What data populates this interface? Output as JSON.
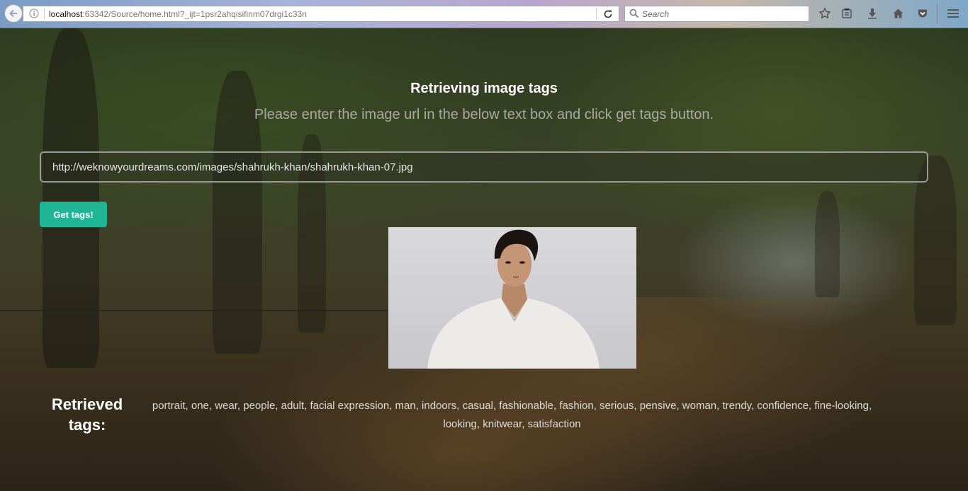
{
  "browser": {
    "url_host": "localhost",
    "url_rest": ":63342/Source/home.html?_ijt=1psr2ahqisifinm07drgi1c33n",
    "search_placeholder": "Search"
  },
  "page": {
    "title": "Retrieving image tags",
    "subtitle": "Please enter the image url in the below text box and click get tags button.",
    "image_url_value": "http://weknowyourdreams.com/images/shahrukh-khan/shahrukh-khan-07.jpg",
    "get_tags_label": "Get tags!",
    "tags_heading": "Retrieved tags:",
    "tags": "portrait, one, wear, people, adult, facial expression, man, indoors, casual, fashionable, fashion, serious, pensive, woman, trendy, confidence, fine-looking, looking, knitwear, satisfaction"
  },
  "colors": {
    "accent_button": "#1fb596"
  },
  "icons": [
    "back-arrow-icon",
    "info-icon",
    "reload-icon",
    "search-icon",
    "bookmark-star-icon",
    "reading-list-icon",
    "download-icon",
    "home-icon",
    "pocket-icon",
    "hamburger-menu-icon"
  ]
}
